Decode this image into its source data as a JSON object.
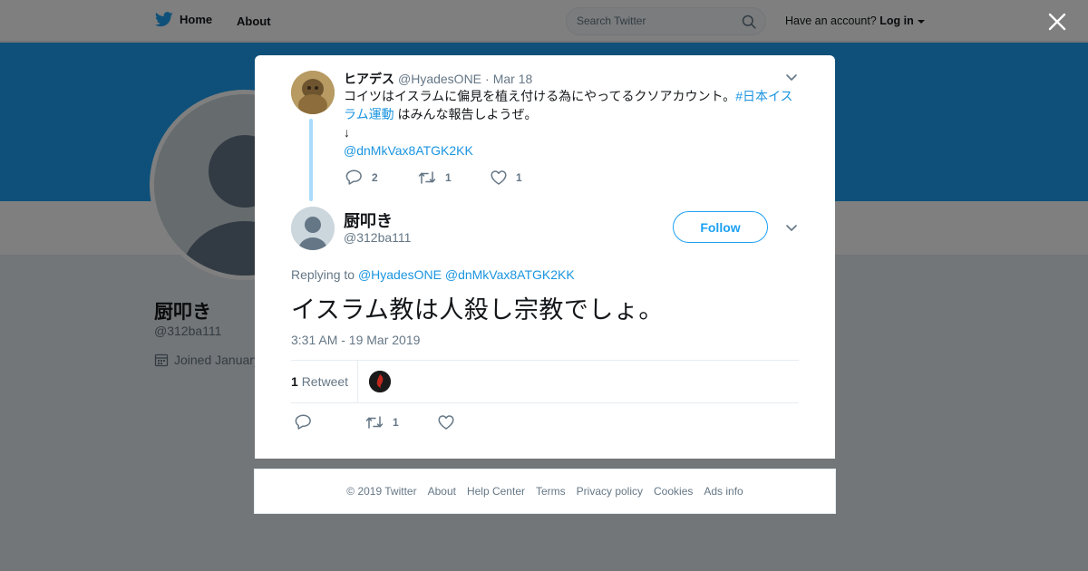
{
  "topbar": {
    "home_label": "Home",
    "about_label": "About",
    "search_placeholder": "Search Twitter",
    "account_prompt": "Have an account?",
    "login_label": "Log in"
  },
  "background_profile": {
    "name": "厨叩き",
    "handle": "@312ba111",
    "joined_text": "Joined January"
  },
  "parent_tweet": {
    "display_name": "ヒアデス",
    "handle": "@HyadesONE",
    "separator": "·",
    "date": "Mar 18",
    "text_before_hashtag": "コイツはイスラムに偏見を植え付ける為にやってるクソアカウント。",
    "hashtag": "#日本イスラム運動",
    "text_after_hashtag": " はみんな報告しようぜ。",
    "arrow_line": "↓",
    "mention": "@dnMkVax8ATGK2KK",
    "reply_count": "2",
    "retweet_count": "1",
    "like_count": "1"
  },
  "main_tweet": {
    "display_name": "厨叩き",
    "handle": "@312ba111",
    "follow_label": "Follow",
    "replying_prefix": "Replying to",
    "replying_mention_1": "@HyadesONE",
    "replying_mention_2": "@dnMkVax8ATGK2KK",
    "text": "イスラム教は人殺し宗教でしょ。",
    "timestamp": "3:31 AM - 19 Mar 2019",
    "retweet_stat_count": "1",
    "retweet_stat_label": "Retweet",
    "retweet_count": "1"
  },
  "footer": {
    "items": [
      "© 2019 Twitter",
      "About",
      "Help Center",
      "Terms",
      "Privacy policy",
      "Cookies",
      "Ads info"
    ]
  },
  "colors": {
    "twitter_blue": "#1da1f2",
    "link_blue": "#1b95e0",
    "thread_line": "#a9dbfb",
    "muted_text": "#657786"
  },
  "icons": [
    "twitter-bird-icon",
    "search-icon",
    "caret-down-icon",
    "close-icon",
    "reply-icon",
    "retweet-icon",
    "like-icon",
    "calendar-icon"
  ]
}
